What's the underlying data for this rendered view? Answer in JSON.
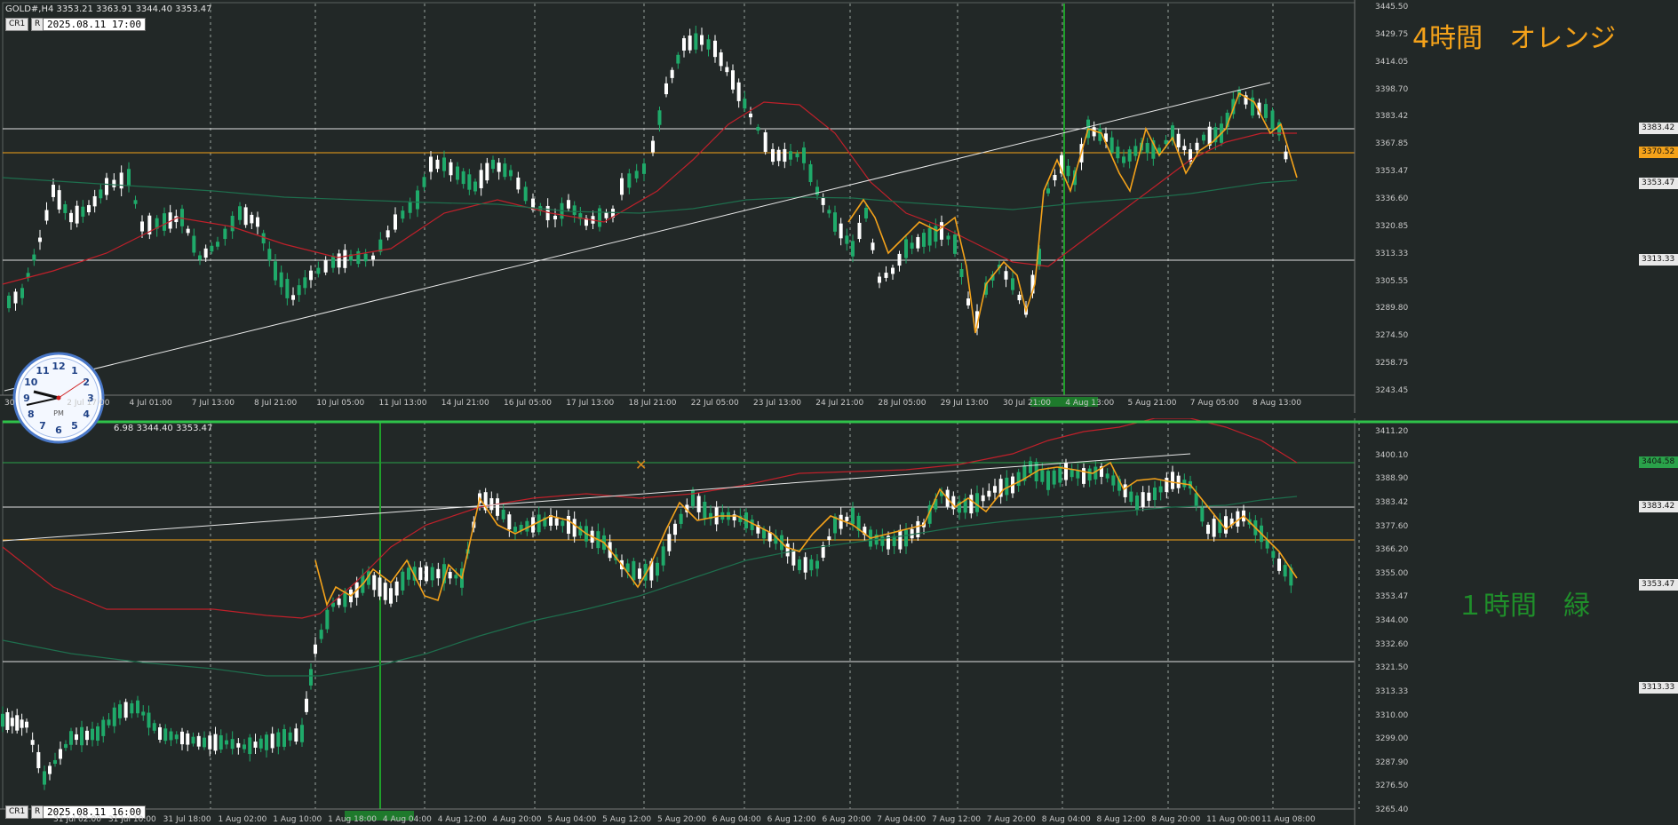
{
  "top_chart": {
    "symbol_info": "GOLD#,H4  3353.21 3363.91 3344.40 3353.47",
    "date_label": "2025.08.11 17:00",
    "annotation": "4時間　オレンジ",
    "annotation_color": "#f4a21a",
    "price_ticks": [
      "3445.50",
      "3429.75",
      "3414.05",
      "3398.70",
      "3383.42",
      "3367.85",
      "3353.47",
      "3336.60",
      "3320.85",
      "3313.33",
      "3305.55",
      "3289.80",
      "3274.50",
      "3258.75",
      "3243.45"
    ],
    "current_price": "3353.47",
    "level_orange": "3370.52",
    "level_white_high": "3383.42",
    "level_white_low": "3313.33",
    "time_ticks": [
      "30",
      "2 Jul 17:00",
      "4 Jul 01:00",
      "7 Jul 13:00",
      "8 Jul 21:00",
      "10 Jul 05:00",
      "11 Jul 13:00",
      "14 Jul 21:00",
      "16 Jul 05:00",
      "17 Jul 13:00",
      "18 Jul 21:00",
      "22 Jul 05:00",
      "23 Jul 13:00",
      "24 Jul 21:00",
      "28 Jul 05:00",
      "29 Jul 13:00",
      "30 Jul 21:00",
      "4 Aug 13:00",
      "5 Aug 21:00",
      "7 Aug 05:00",
      "8 Aug 13:00"
    ],
    "highlight_time": "2025.08.04 01:00"
  },
  "bottom_chart": {
    "symbol_info": "6.98 3344.40 3353.47",
    "date_label": "2025.08.11 16:00",
    "annotation": "１時間　緑",
    "annotation_color": "#1f8f2a",
    "price_ticks": [
      "3411.20",
      "3400.10",
      "3388.90",
      "3383.42",
      "3377.60",
      "3366.20",
      "3355.00",
      "3353.47",
      "3344.00",
      "3332.60",
      "3321.50",
      "3313.33",
      "3310.00",
      "3299.00",
      "3287.90",
      "3276.50",
      "3265.40"
    ],
    "current_price": "3353.47",
    "level_green": "3404.58",
    "level_white_high": "3383.42",
    "level_white_low": "3313.33",
    "time_ticks": [
      "31 Jul 02:00",
      "31 Jul 10:00",
      "31 Jul 18:00",
      "1 Aug 02:00",
      "1 Aug 10:00",
      "1 Aug 18:00",
      "4 Aug 04:00",
      "4 Aug 12:00",
      "4 Aug 20:00",
      "5 Aug 04:00",
      "5 Aug 12:00",
      "5 Aug 20:00",
      "6 Aug 04:00",
      "6 Aug 12:00",
      "6 Aug 20:00",
      "7 Aug 04:00",
      "7 Aug 12:00",
      "7 Aug 20:00",
      "8 Aug 04:00",
      "8 Aug 12:00",
      "8 Aug 20:00",
      "11 Aug 00:00",
      "11 Aug 08:00"
    ]
  },
  "cr_label": "CR1",
  "r_label": "R",
  "clock": {
    "pm_label": "PM",
    "numbers": [
      "12",
      "1",
      "2",
      "3",
      "4",
      "5",
      "6",
      "7",
      "8",
      "9",
      "10",
      "11"
    ]
  },
  "colors": {
    "bg": "#222827",
    "bull": "#1faa6a",
    "bear": "#ffffff",
    "ma_red": "#c0202a",
    "ma_green": "#1e6e4d",
    "zigzag": "#f4a21a",
    "grid": "#9aa39f"
  }
}
